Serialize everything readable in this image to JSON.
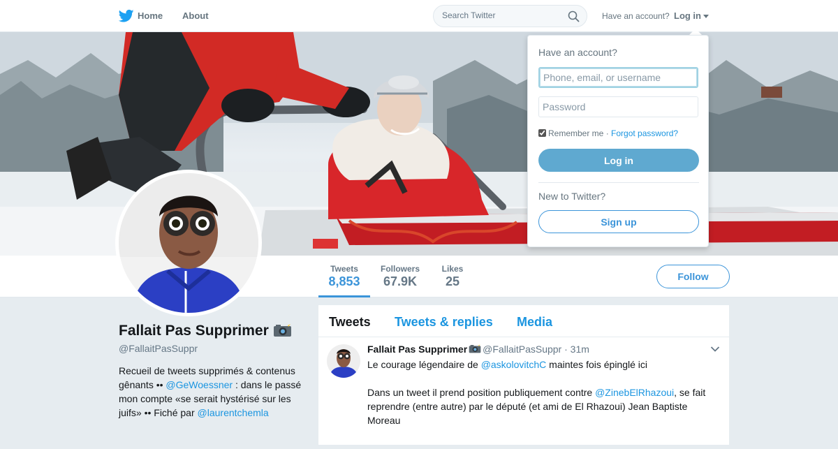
{
  "nav": {
    "logo_icon": "twitter-bird-icon",
    "home_label": "Home",
    "about_label": "About",
    "search_placeholder": "Search Twitter",
    "have_account": "Have an account?",
    "login_label": "Log in"
  },
  "profile": {
    "display_name": "Fallait Pas Supprimer",
    "handle": "@FallaitPasSuppr",
    "bio": {
      "part1": "Recueil de tweets supprimés & contenus gênants •• ",
      "mention1": "@GeWoessner",
      "part2": " : dans le passé mon compte «se serait hystérisé sur les juifs» •• Fiché par ",
      "mention2": "@laurentchemla"
    }
  },
  "stats": [
    {
      "label": "Tweets",
      "value": "8,853"
    },
    {
      "label": "Followers",
      "value": "67.9K"
    },
    {
      "label": "Likes",
      "value": "25"
    }
  ],
  "follow_label": "Follow",
  "timeline": {
    "tabs": [
      "Tweets",
      "Tweets & replies",
      "Media"
    ],
    "active_tab": "Tweets"
  },
  "tweet": {
    "name": "Fallait Pas Supprimer",
    "handle": "@FallaitPasSuppr",
    "time": "· 31m",
    "line1_pre": "Le courage légendaire de ",
    "line1_mention": "@askolovitchC",
    "line1_post": " maintes fois épinglé ici",
    "line2_pre": "Dans un tweet il prend position publiquement contre ",
    "line2_mention": "@ZinebElRhazoui",
    "line2_post": ", se fait reprendre (entre autre) par le député (et ami de El Rhazoui) Jean Baptiste Moreau"
  },
  "login_dropdown": {
    "title": "Have an account?",
    "username_placeholder": "Phone, email, or username",
    "password_placeholder": "Password",
    "remember_label": "Remember me",
    "separator": " · ",
    "forgot_label": "Forgot password?",
    "login_button": "Log in",
    "new_to_twitter": "New to Twitter?",
    "signup_button": "Sign up"
  },
  "colors": {
    "accent": "#3b94d9",
    "link": "#1b95e0",
    "background": "#e6ecf0"
  }
}
